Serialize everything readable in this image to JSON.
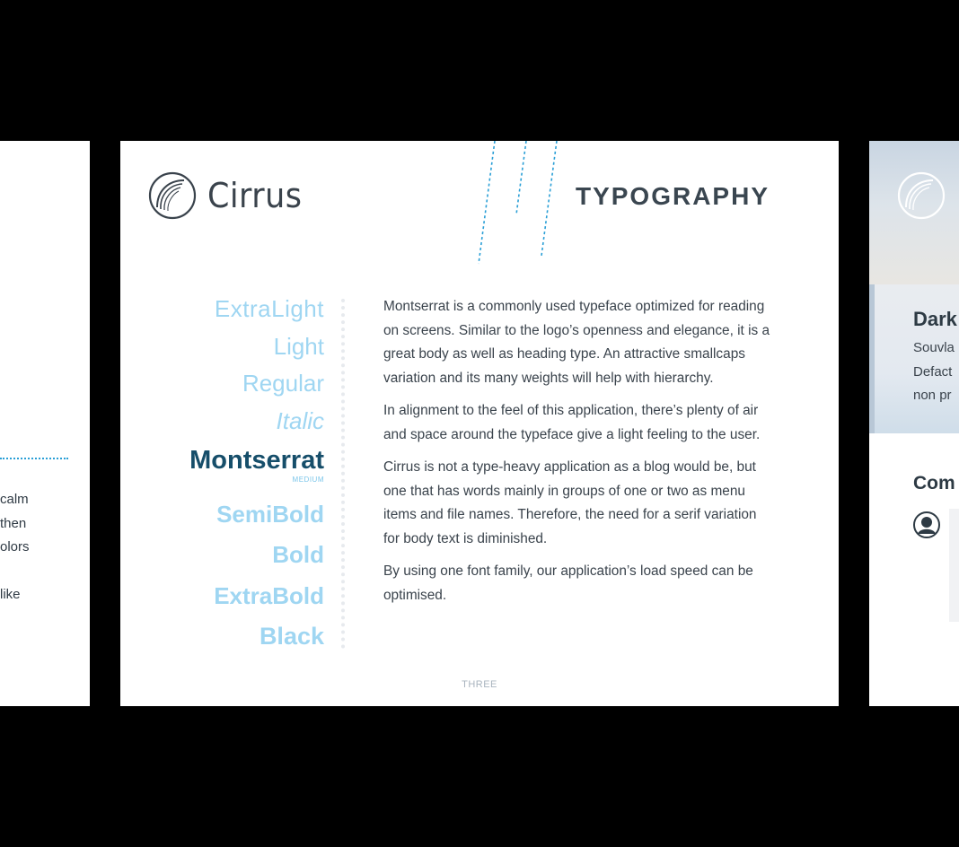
{
  "prev_slide": {
    "lines": [
      "calm",
      "then",
      "olors",
      "",
      "like"
    ]
  },
  "main_slide": {
    "logo_text": "Cirrus",
    "title": "TYPOGRAPHY",
    "weights": {
      "extralight": "ExtraLight",
      "light": "Light",
      "regular": "Regular",
      "italic": "Italic",
      "medium": "Montserrat",
      "medium_sub": "MEDIUM",
      "semibold": "SemiBold",
      "bold": "Bold",
      "extrabold": "ExtraBold",
      "black": "Black"
    },
    "paragraphs": [
      "Montserrat is a commonly used typeface optimized for reading on screens. Similar to the logo’s openness and elegance, it is a great body as well as heading type. An attractive smallcaps variation and its many weights will help with hierarchy.",
      "In alignment to the feel of this application, there’s plenty of air and space around the typeface give a light feeling to the user.",
      "Cirrus is not a type-heavy application as a blog would be, but one that has words mainly in groups of one or two as menu items and file names. Therefore, the need for a serif variation for body text is diminished.",
      "By using one font family, our application’s load speed can be optimised."
    ],
    "page_number": "THREE"
  },
  "next_slide": {
    "heading": "Dark",
    "lines": [
      "Souvla",
      "Defact",
      "non pr"
    ],
    "comments_heading": "Com"
  },
  "colors": {
    "background": "#000000",
    "slide": "#ffffff",
    "accent_blue": "#2a9fd6",
    "weight_light_blue": "#9fd6f2",
    "weight_dark_blue": "#164e6a",
    "text": "#3a434c"
  }
}
